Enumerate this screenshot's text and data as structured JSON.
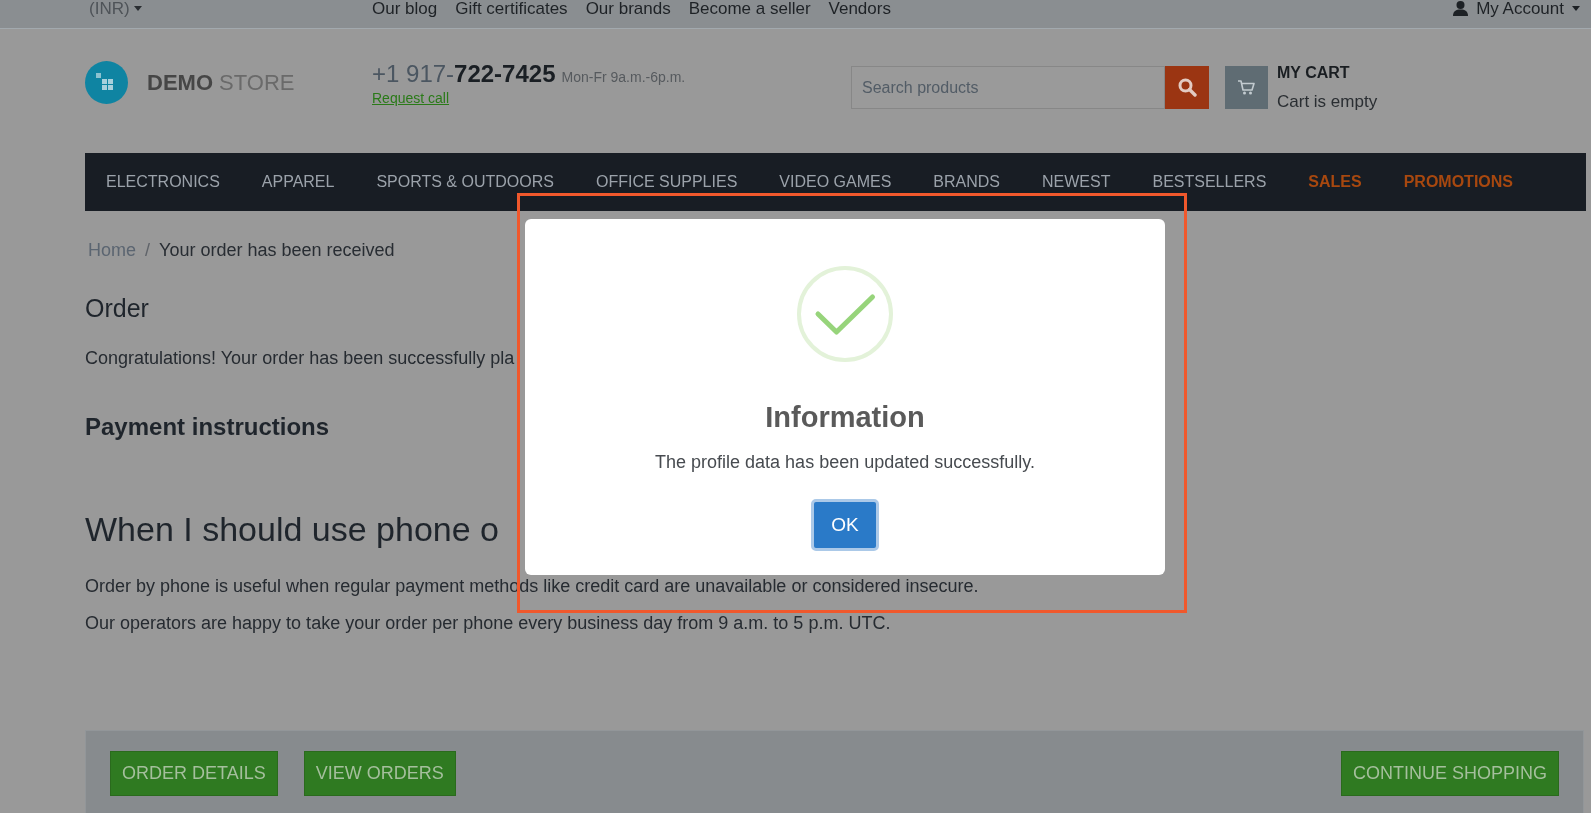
{
  "top_bar": {
    "currency": "(INR)",
    "links": [
      "Our blog",
      "Gift certificates",
      "Our brands",
      "Become a seller",
      "Vendors"
    ],
    "account": "My Account"
  },
  "header": {
    "logo": "**DEMO** STORE",
    "phone": "+1 917-**722-7425**",
    "hours": "Mon-Fr 9a.m.-6p.m.",
    "request_call": "Request call",
    "search": {
      "placeholder": "Search products"
    },
    "cart": {
      "title": "MY CART",
      "status": "Cart is empty"
    }
  },
  "nav": [
    {
      "label": "ELECTRONICS",
      "kind": "category"
    },
    {
      "label": "APPAREL",
      "kind": "category"
    },
    {
      "label": "SPORTS & OUTDOORS",
      "kind": "category"
    },
    {
      "label": "OFFICE SUPPLIES",
      "kind": "category"
    },
    {
      "label": "VIDEO GAMES",
      "kind": "category"
    },
    {
      "label": "BRANDS",
      "kind": "category"
    },
    {
      "label": "NEWEST",
      "kind": "category"
    },
    {
      "label": "BESTSELLERS",
      "kind": "category"
    },
    {
      "label": "SALES",
      "kind": "promo"
    },
    {
      "label": "PROMOTIONS",
      "kind": "promo"
    }
  ],
  "breadcrumb": {
    "separator": "/",
    "items": [
      {
        "label": "Home",
        "current": false
      },
      {
        "label": "Your order has been received",
        "current": true
      }
    ]
  },
  "content": {
    "title": "Order",
    "message": "Congratulations! Your order has been successfully pla",
    "payment_heading": "Payment instructions",
    "phone_heading": "When I should use phone o",
    "paragraphs": [
      "Order by phone is useful when regular payment methods like credit card are unavailable or considered insecure.",
      "Our operators are happy to take your order per phone every business day from 9 a.m. to 5 p.m. UTC."
    ]
  },
  "actions": {
    "left": [
      "ORDER DETAILS",
      "VIEW ORDERS"
    ],
    "right": [
      "CONTINUE SHOPPING"
    ]
  },
  "dialog": {
    "title": "Information",
    "message": "The profile data has been updated successfully.",
    "button": "OK"
  }
}
